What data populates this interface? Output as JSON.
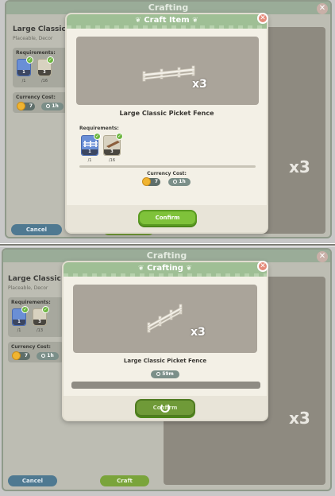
{
  "top": {
    "background": {
      "title": "Crafting",
      "item_title": "Large Classic Pic",
      "item_subtitle": "Placeable, Decor",
      "requirements_label": "Requirements:",
      "currency_label": "Currency Cost:",
      "req1_count": "1",
      "req1_need": "/1",
      "req2_count": "3",
      "req2_need": "/16",
      "coin_value": "7",
      "time_value": "1h",
      "cancel_label": "Cancel",
      "preview_multiplier": "x3"
    },
    "dialog": {
      "title": "Craft Item",
      "preview_multiplier": "x3",
      "item_name": "Large Classic Picket Fence",
      "requirements_label": "Requirements:",
      "req1_count": "1",
      "req1_need": "/1",
      "req2_count": "3",
      "req2_need": "/16",
      "currency_label": "Currency Cost:",
      "coin_value": "7",
      "time_value": "1h",
      "confirm_label": "Confirm"
    }
  },
  "bottom": {
    "background": {
      "title": "Crafting",
      "item_title": "Large Classic Pic",
      "item_subtitle": "Placeable, Decor",
      "requirements_label": "Requirements:",
      "currency_label": "Currency Cost:",
      "req1_count": "1",
      "req1_need": "/1",
      "req2_count": "3",
      "req2_need": "/13",
      "coin_value": "7",
      "time_value": "1h",
      "cancel_label": "Cancel",
      "craft_label": "Craft",
      "preview_multiplier": "x3"
    },
    "dialog": {
      "title": "Crafting",
      "preview_multiplier": "x3",
      "item_name": "Large Classic Picket Fence",
      "time_remaining": "59m",
      "progress": 0,
      "confirm_label": "Confirm"
    }
  },
  "colors": {
    "accent_green": "#7fc23a",
    "header_green": "#9fbf95",
    "cancel_blue": "#4f7991",
    "close_red": "#e58a7a"
  }
}
